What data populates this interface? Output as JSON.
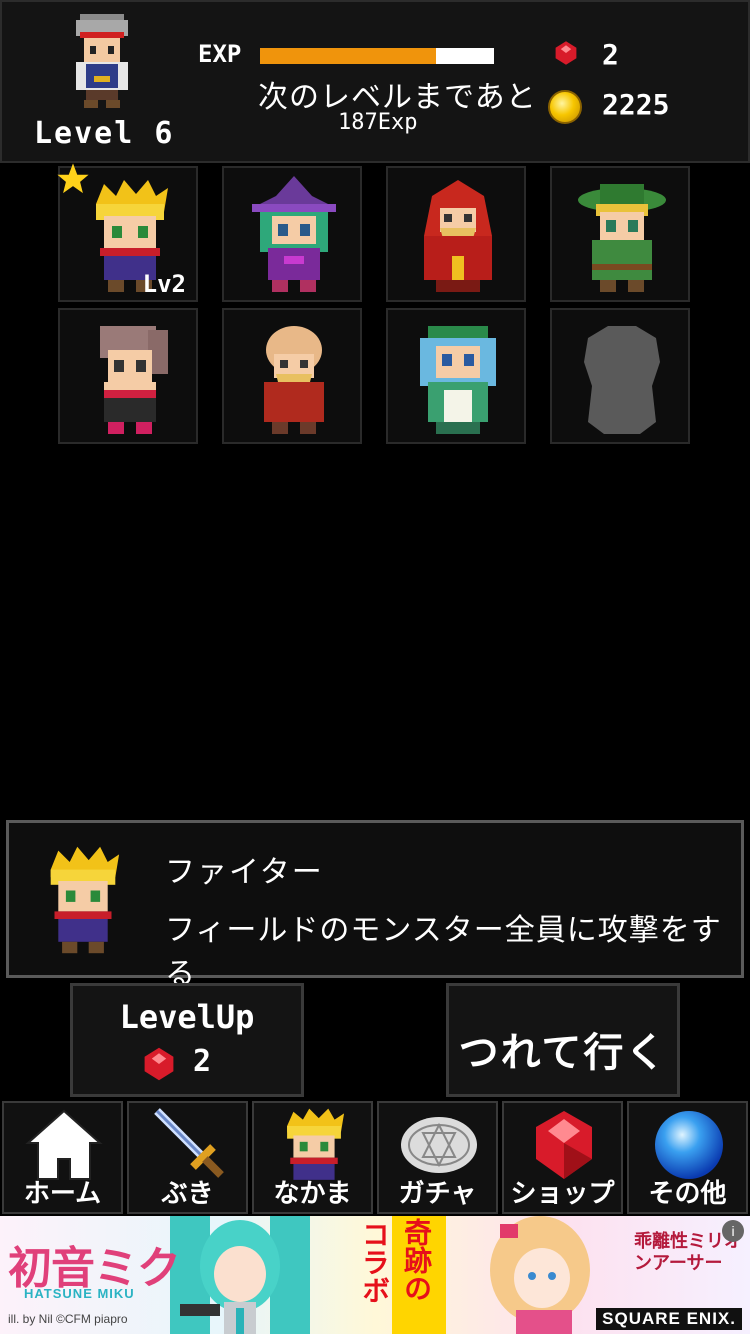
{
  "player": {
    "level_label": "Level 6",
    "exp_label": "EXP",
    "exp_progress": 0.75,
    "next_level_label": "次のレベルまであと",
    "exp_remaining": "187Exp",
    "gems": "2",
    "coins": "2225"
  },
  "roster": [
    {
      "name": "fighter",
      "level": "Lv2",
      "favorite": true
    },
    {
      "name": "witch",
      "level": ""
    },
    {
      "name": "red-mage",
      "level": ""
    },
    {
      "name": "ranger",
      "level": ""
    },
    {
      "name": "dancer",
      "level": ""
    },
    {
      "name": "old-monk",
      "level": ""
    },
    {
      "name": "priestess",
      "level": ""
    },
    {
      "name": "locked",
      "level": ""
    }
  ],
  "selected": {
    "name": "ファイター",
    "description": "フィールドのモンスター全員に攻撃をする"
  },
  "buttons": {
    "levelup_label": "LevelUp",
    "levelup_cost": "2",
    "take_label": "つれて行く"
  },
  "nav": [
    {
      "label": "ホーム",
      "icon": "home-icon"
    },
    {
      "label": "ぶき",
      "icon": "sword-icon"
    },
    {
      "label": "なかま",
      "icon": "party-icon"
    },
    {
      "label": "ガチャ",
      "icon": "gacha-icon"
    },
    {
      "label": "ショップ",
      "icon": "shop-gem-icon"
    },
    {
      "label": "その他",
      "icon": "other-orb-icon"
    }
  ],
  "ad": {
    "miku_title": "初音ミク",
    "miku_sub": "HATSUNE MIKU",
    "credit": "ill. by Nil ©CFM piapro",
    "collab_top": "奇跡の",
    "collab_bottom": "コラボ",
    "game_title": "乖離性ミリオンアーサー",
    "brand": "SQUARE ENIX."
  },
  "colors": {
    "exp_fill": "#f0940c",
    "gem": "#d81b2a",
    "coin": "#f7c600"
  }
}
